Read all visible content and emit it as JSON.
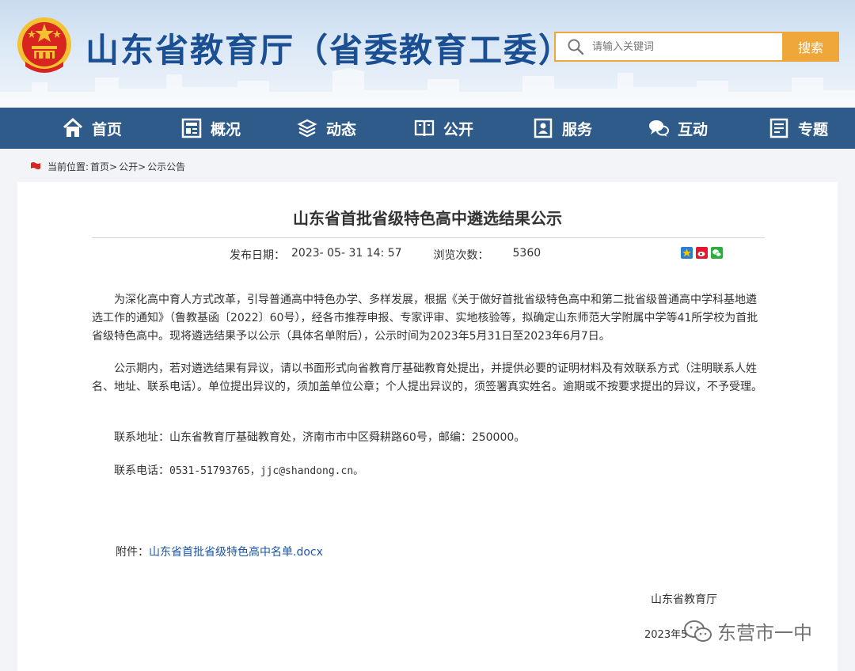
{
  "header": {
    "site_title": "山东省教育厅（省委教育工委）",
    "search": {
      "placeholder": "请输入关键词",
      "button_label": "搜索"
    }
  },
  "nav": {
    "items": [
      {
        "label": "首页",
        "icon": "home-icon"
      },
      {
        "label": "概况",
        "icon": "overview-icon"
      },
      {
        "label": "动态",
        "icon": "news-icon"
      },
      {
        "label": "公开",
        "icon": "open-book-icon"
      },
      {
        "label": "服务",
        "icon": "service-icon"
      },
      {
        "label": "互动",
        "icon": "chat-icon"
      },
      {
        "label": "专题",
        "icon": "topic-icon"
      }
    ]
  },
  "breadcrumb": {
    "prefix": "当前位置:",
    "items": [
      "首页>",
      "公开>",
      "公示公告"
    ]
  },
  "article": {
    "title": "山东省首批省级特色高中遴选结果公示",
    "publish_label": "发布日期：",
    "publish_date": "2023- 05- 31 14: 57",
    "views_label": "浏览次数：",
    "views": "5360",
    "share_icons": [
      "qzone-icon",
      "weibo-icon",
      "wechat-icon"
    ],
    "paragraphs": [
      "为深化高中育人方式改革，引导普通高中特色办学、多样发展，根据《关于做好首批省级特色高中和第二批省级普通高中学科基地遴选工作的通知》（鲁教基函〔2022〕60号），经各市推荐申报、专家评审、实地核验等，拟确定山东师范大学附属中学等41所学校为首批省级特色高中。现将遴选结果予以公示（具体名单附后），公示时间为2023年5月31日至2023年6月7日。",
      "公示期内，若对遴选结果有异议，请以书面形式向省教育厅基础教育处提出，并提供必要的证明材料及有效联系方式（注明联系人姓名、地址、联系电话）。单位提出异议的，须加盖单位公章；个人提出异议的，须签署真实姓名。逾期或不按要求提出的异议，不予受理。"
    ],
    "contact_address": "联系地址：山东省教育厅基础教育处，济南市市中区舜耕路60号，邮编：250000。",
    "contact_phone_label": "联系电话：",
    "contact_phone": "0531-51793765，jjc@shandong.cn。",
    "attachment_label": "附件：",
    "attachment_name": "山东省首批省级特色高中名单.docx",
    "signature_org": "山东省教育厅",
    "signature_date": "2023年5"
  },
  "watermark": {
    "text": "东营市一中"
  },
  "colors": {
    "nav_bg": "#2f5b8a",
    "title_blue": "#1b4f93",
    "accent_orange": "#f0a73a",
    "link_blue": "#1a56a8"
  }
}
